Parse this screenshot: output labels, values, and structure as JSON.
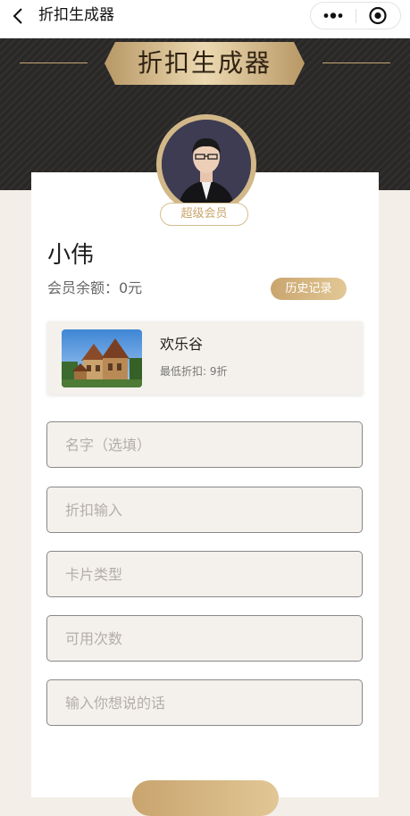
{
  "nav": {
    "title": "折扣生成器"
  },
  "header": {
    "banner_title": "折扣生成器"
  },
  "profile": {
    "badge": "超级会员",
    "name": "小伟",
    "balance": "会员余额：0元",
    "history_button": "历史记录"
  },
  "venue": {
    "name": "欢乐谷",
    "min_discount": "最低折扣: 9折"
  },
  "form": {
    "name_placeholder": "名字（选填）",
    "discount_placeholder": "折扣输入",
    "card_type_placeholder": "卡片类型",
    "uses_placeholder": "可用次数",
    "message_placeholder": "输入你想说的话"
  },
  "colors": {
    "gold": "#c8a46a",
    "hero_bg": "#2a2827",
    "page_bg": "#f3efe8"
  }
}
